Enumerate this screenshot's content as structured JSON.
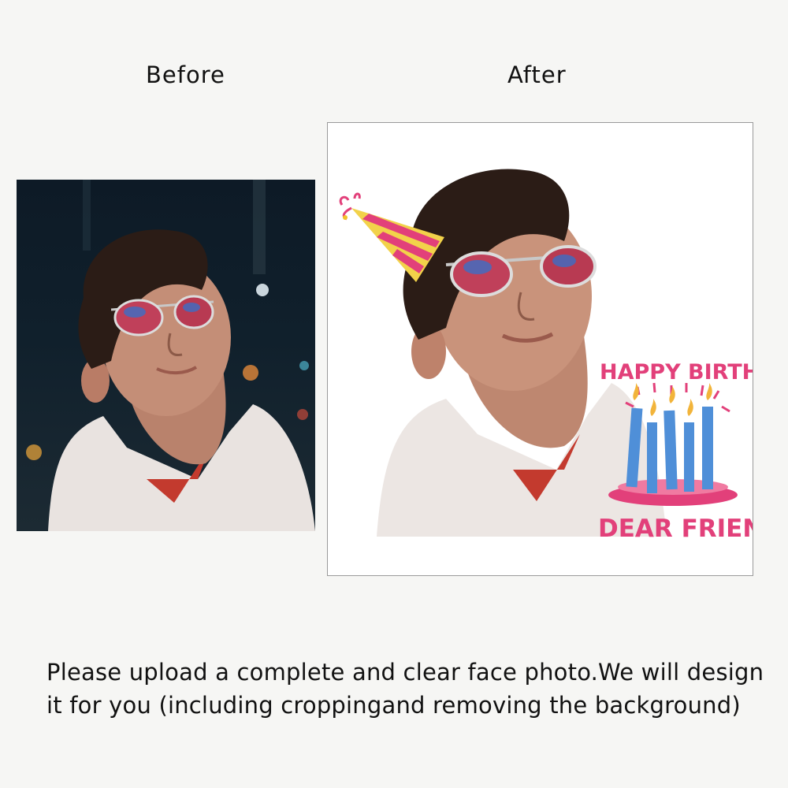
{
  "labels": {
    "before": "Before",
    "after": "After"
  },
  "overlay": {
    "line1": "HAPPY BIRTHDAY",
    "line2": "DEAR FRIEND"
  },
  "caption": "Please upload a complete and clear face photo.We will design\nit for you (including croppingand removing the background)",
  "colors": {
    "background": "#f6f6f4",
    "accent_pink": "#e2407a",
    "candle_blue": "#4f8fd8",
    "hat_yellow": "#f2d24a"
  }
}
